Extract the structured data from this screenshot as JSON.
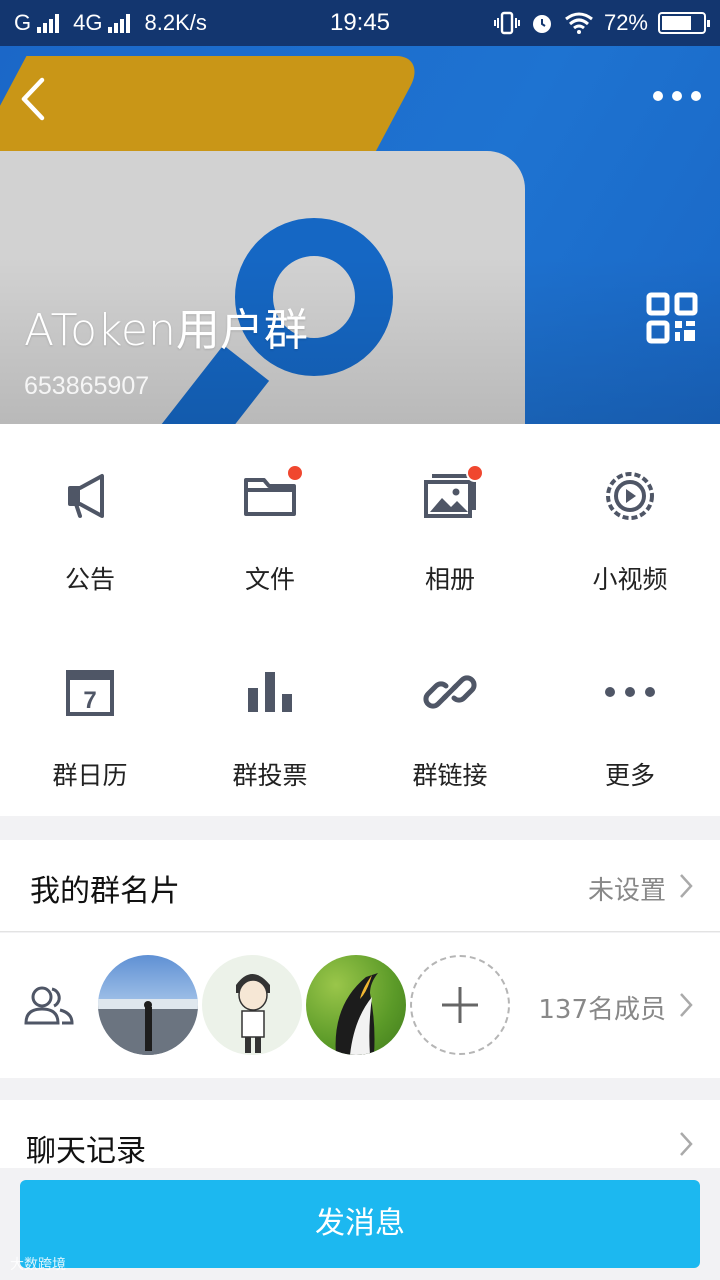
{
  "status_bar": {
    "carrier": "G",
    "network": "4G",
    "speed": "8.2K/s",
    "time": "19:45",
    "battery": "72%",
    "battery_level": 0.72
  },
  "header": {
    "group_name": "AToken用户群",
    "group_id": "653865907",
    "back_icon": "chevron-left-icon",
    "more_icon": "ellipsis-icon",
    "qr_icon": "qr-code-icon"
  },
  "features": [
    {
      "label": "公告",
      "icon": "megaphone-icon",
      "badge": false
    },
    {
      "label": "文件",
      "icon": "folder-icon",
      "badge": true
    },
    {
      "label": "相册",
      "icon": "album-icon",
      "badge": true
    },
    {
      "label": "小视频",
      "icon": "video-icon",
      "badge": false
    },
    {
      "label": "群日历",
      "icon": "calendar-icon",
      "badge": false
    },
    {
      "label": "群投票",
      "icon": "bar-chart-icon",
      "badge": false
    },
    {
      "label": "群链接",
      "icon": "link-icon",
      "badge": false
    },
    {
      "label": "更多",
      "icon": "ellipsis-icon",
      "badge": false
    }
  ],
  "calendar_day": "7",
  "card_row": {
    "title": "我的群名片",
    "value": "未设置"
  },
  "members_row": {
    "count_label": "137名成员"
  },
  "history_row": {
    "title": "聊天记录"
  },
  "send_button": {
    "label": "发消息"
  },
  "watermark": "大数跨境",
  "colors": {
    "header_blue": "#1b67c8",
    "badge_red": "#f0472f",
    "button_blue": "#1cb8f0",
    "icon_gray": "#4f5666"
  }
}
